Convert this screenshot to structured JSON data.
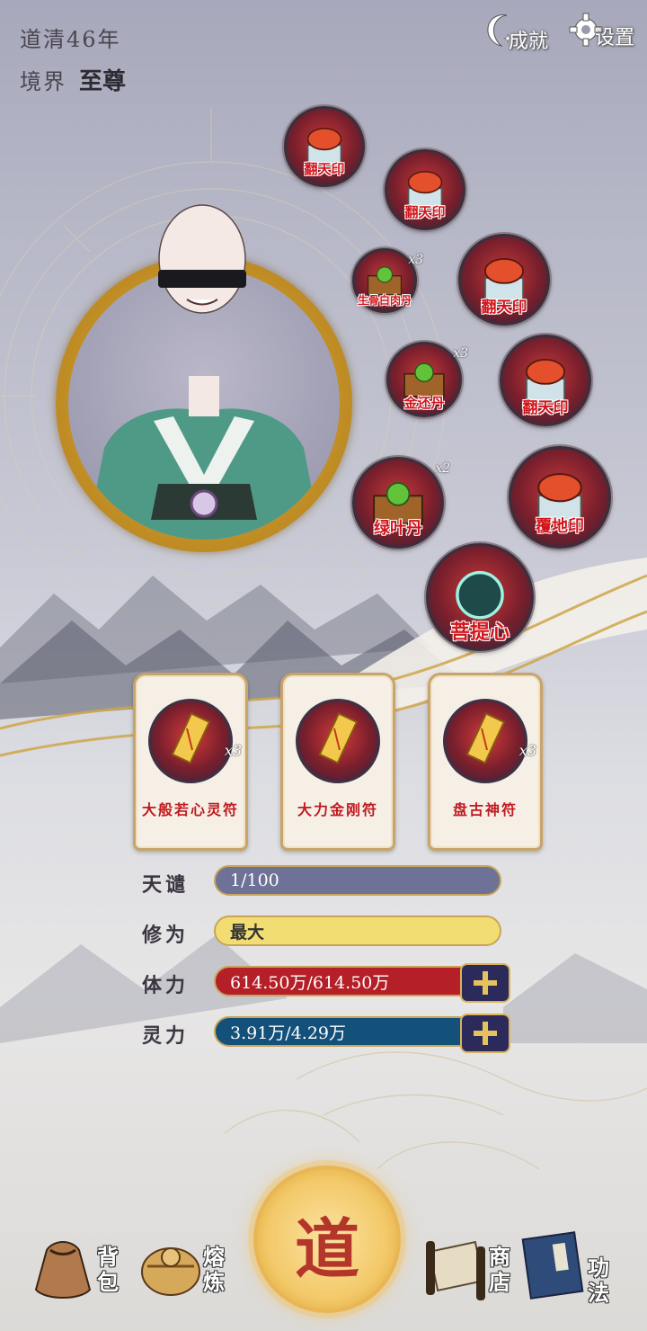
{
  "header": {
    "era_text": "道清46年",
    "realm_label": "境界",
    "realm_value": "至尊",
    "achievements_label": "成就",
    "settings_label": "设置"
  },
  "items": [
    {
      "name": "翻天印",
      "qty": ""
    },
    {
      "name": "翻天印",
      "qty": ""
    },
    {
      "name": "生骨白肉丹",
      "qty": "x3"
    },
    {
      "name": "翻天印",
      "qty": ""
    },
    {
      "name": "金还丹",
      "qty": "x3"
    },
    {
      "name": "翻天印",
      "qty": ""
    },
    {
      "name": "绿叶丹",
      "qty": "x2"
    },
    {
      "name": "覆地印",
      "qty": ""
    },
    {
      "name": "菩提心",
      "qty": ""
    }
  ],
  "talismans": [
    {
      "name": "大般若心灵符",
      "qty": "x3"
    },
    {
      "name": "大力金刚符",
      "qty": ""
    },
    {
      "name": "盘古神符",
      "qty": "x3"
    }
  ],
  "stats": {
    "tianqian_label": "天谴",
    "tianqian_value": "1/100",
    "tianqian_fraction": 0.01,
    "xiuwei_label": "修为",
    "xiuwei_value": "最大",
    "tili_label": "体力",
    "tili_value": "614.50万/614.50万",
    "lingli_label": "灵力",
    "lingli_value": "3.91万/4.29万"
  },
  "nav": {
    "bag_label": "背包",
    "smelt_label": "熔炼",
    "center_glyph": "道",
    "shop_label": "商店",
    "skills_label": "功法"
  },
  "colors": {
    "item_name_red": "#d3141b",
    "bar_blue_gray": "#6f7297",
    "bar_yellow": "#f2dd73",
    "bar_red": "#b51f27",
    "bar_teal": "#13507a",
    "gold": "#d8b35a"
  }
}
